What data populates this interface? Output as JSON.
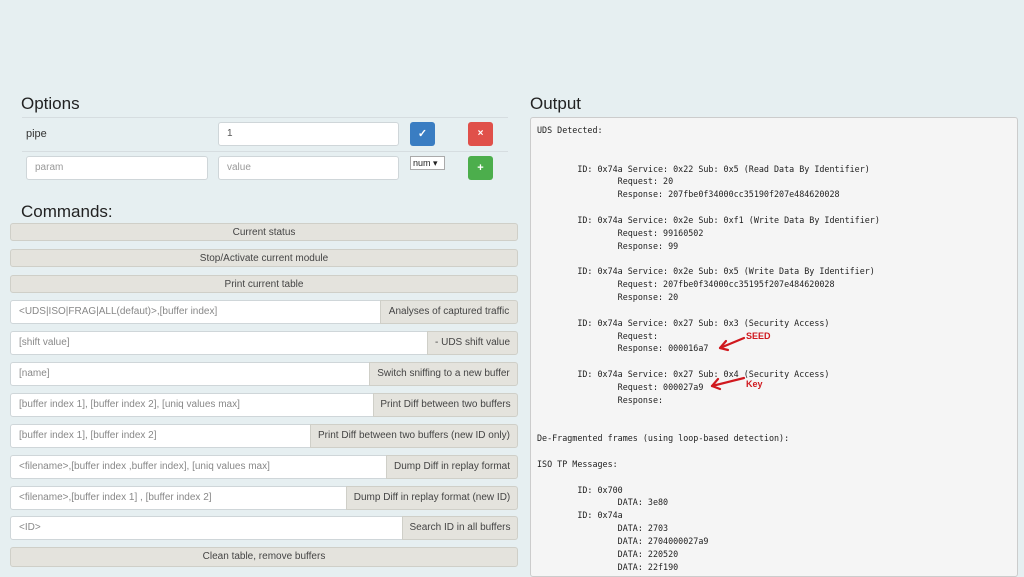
{
  "options": {
    "title": "Options",
    "rows": [
      {
        "label": "pipe",
        "value": "1"
      }
    ],
    "new_param": {
      "param_placeholder": "param",
      "value_placeholder": "value",
      "type_select": "num"
    },
    "confirm_icon": "check-icon",
    "remove_icon": "close-icon",
    "add_icon": "plus-icon",
    "confirm_glyph": "✓",
    "remove_glyph": "×",
    "add_glyph": "+"
  },
  "commands": {
    "title": "Commands:",
    "current_status": "Current status",
    "stop_activate": "Stop/Activate current module",
    "print_table": "Print current table",
    "rows": [
      {
        "placeholder": "<UDS|ISO|FRAG|ALL(defaut)>,[buffer index]",
        "button": "Analyses of captured traffic"
      },
      {
        "placeholder": "[shift value]",
        "button": "- UDS shift value"
      },
      {
        "placeholder": "[name]",
        "button": "Switch sniffing to a new buffer"
      },
      {
        "placeholder": "[buffer index 1], [buffer index 2], [uniq values max]",
        "button": "Print Diff between two buffers"
      },
      {
        "placeholder": "[buffer index 1], [buffer index 2]",
        "button": "Print Diff between two buffers (new ID only)"
      },
      {
        "placeholder": "<filename>,[buffer index ,buffer index], [uniq values max]",
        "button": "Dump Diff in replay format"
      },
      {
        "placeholder": "<filename>,[buffer index 1] , [buffer index 2]",
        "button": "Dump Diff in replay format (new ID)"
      },
      {
        "placeholder": "<ID>",
        "button": "Search ID in all buffers"
      }
    ],
    "clean_table": "Clean table, remove buffers"
  },
  "output": {
    "title": "Output",
    "text": "UDS Detected:\n\n\n        ID: 0x74a Service: 0x22 Sub: 0x5 (Read Data By Identifier)\n                Request: 20\n                Response: 207fbe0f34000cc35190f207e484620028\n\n        ID: 0x74a Service: 0x2e Sub: 0xf1 (Write Data By Identifier)\n                Request: 99160502\n                Response: 99\n\n        ID: 0x74a Service: 0x2e Sub: 0x5 (Write Data By Identifier)\n                Request: 207fbe0f34000cc35195f207e484620028\n                Response: 20\n\n        ID: 0x74a Service: 0x27 Sub: 0x3 (Security Access)\n                Request:\n                Response: 000016a7\n\n        ID: 0x74a Service: 0x27 Sub: 0x4 (Security Access)\n                Request: 000027a9\n                Response:\n\n\nDe-Fragmented frames (using loop-based detection):\n\nISO TP Messages:\n\n        ID: 0x700\n                DATA: 3e80\n        ID: 0x74a\n                DATA: 2703\n                DATA: 2704000027a9\n                DATA: 220520\n                DATA: 22f190",
    "annotation_seed": "SEED",
    "annotation_key": "Key"
  },
  "colors": {
    "annotation": "#d0181e",
    "primary": "#3a7dc2",
    "danger": "#e0504a",
    "success": "#4cae4c"
  }
}
